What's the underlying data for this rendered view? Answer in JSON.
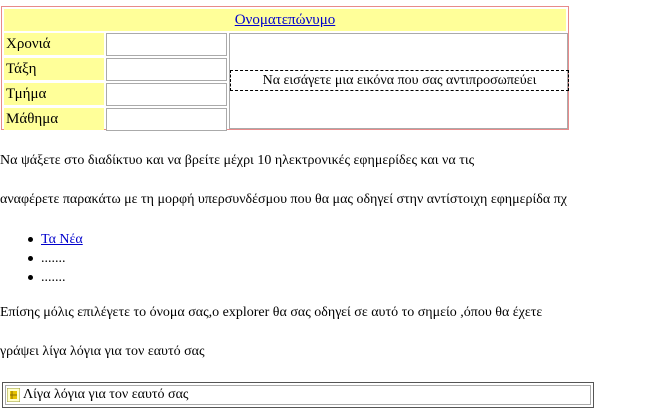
{
  "form": {
    "title_link": "Ονοματεπώνυμο",
    "fields": [
      {
        "label": "Χρονιά",
        "value": ""
      },
      {
        "label": "Τάξη",
        "value": ""
      },
      {
        "label": "Τμήμα",
        "value": ""
      },
      {
        "label": "Μάθημα",
        "value": ""
      }
    ],
    "image_placeholder": "Να εισάγετε μια εικόνα που σας αντιπροσωπεύει"
  },
  "instructions": {
    "line1": "Να ψάξετε στο διαδίκτυο και να βρείτε μέχρι 10 ηλεκτρονικές εφημερίδες και να τις",
    "line2": "αναφέρετε παρακάτω με τη μορφή υπερσυνδέσμου που θα μας οδηγεί στην αντίστοιχη εφημερίδα πχ"
  },
  "newspapers": [
    {
      "text": "Τα Νέα",
      "link": true
    },
    {
      "text": ".......",
      "link": false
    },
    {
      "text": ".......",
      "link": false
    }
  ],
  "about_note": {
    "line1": "Επίσης μόλις επιλέγετε το όνομα σας,ο explorer θα σας οδηγεί σε αυτό το σημείο ,όπου θα έχετε",
    "line2": "γράψει λίγα λόγια για τον εαυτό σας"
  },
  "about_box": {
    "text": "Λίγα λόγια για τον εαυτό σας",
    "icon": "anchor-marker-icon"
  },
  "colors": {
    "label_bg": "#ffff99",
    "link": "#0000cc",
    "table_border": "#e88a8a"
  }
}
